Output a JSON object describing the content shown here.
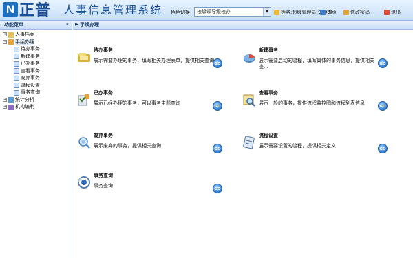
{
  "header": {
    "logo_mark": "N",
    "logo_text": "正普",
    "app_title": "人事信息管理系统",
    "role_label": "角色切换",
    "role_value": "校级领导级校办",
    "user_text": "姓名:超级管理员(9999)",
    "home_label": "首页",
    "change_password_label": "修改密码",
    "logout_label": "退出",
    "brand_color": "#1a4e96"
  },
  "sidebar": {
    "title": "功能菜单",
    "collapse_glyph": "«",
    "items": [
      {
        "label": "人事档案",
        "level": 0,
        "expand": "+",
        "icon": "folder-icon"
      },
      {
        "label": "手续办理",
        "level": 0,
        "expand": "-",
        "icon": "folder-open-icon",
        "selected": true
      },
      {
        "label": "待办事务",
        "level": 1,
        "icon": "page-icon"
      },
      {
        "label": "新建事务",
        "level": 1,
        "icon": "page-icon"
      },
      {
        "label": "已办事务",
        "level": 1,
        "icon": "page-icon"
      },
      {
        "label": "查看事务",
        "level": 1,
        "icon": "page-icon"
      },
      {
        "label": "废弃事务",
        "level": 1,
        "icon": "page-icon"
      },
      {
        "label": "流程设置",
        "level": 1,
        "icon": "page-icon"
      },
      {
        "label": "事务查询",
        "level": 1,
        "icon": "page-icon"
      },
      {
        "label": "统计分析",
        "level": 0,
        "expand": "+",
        "icon": "chart-icon"
      },
      {
        "label": "机构编制",
        "level": 0,
        "expand": "+",
        "icon": "org-icon"
      }
    ]
  },
  "main": {
    "title": "手续办理",
    "go_label": "GO",
    "cards": [
      {
        "title": "待办事务",
        "desc": "展示需要办理的事务，填写相关办理表单，提供相关查询",
        "icon": "pending-task-icon"
      },
      {
        "title": "新建事务",
        "desc": "展示需要启动的流程，填写具体的事务信息，提供相关查...",
        "icon": "new-task-icon"
      },
      {
        "title": "已办事务",
        "desc": "展示已经办理的事务，可以事务主题查询",
        "icon": "done-task-icon"
      },
      {
        "title": "查看事务",
        "desc": "展示一般的事务，提供流程监控图和流程列表信息",
        "icon": "view-task-icon"
      },
      {
        "title": "废弃事务",
        "desc": "展示废弃的事务，提供相关查询",
        "icon": "discarded-task-icon"
      },
      {
        "title": "流程设置",
        "desc": "展示需要设置的流程，提供相关定义",
        "icon": "workflow-settings-icon"
      },
      {
        "title": "事务查询",
        "desc": "事务查询",
        "icon": "task-query-icon"
      }
    ]
  }
}
